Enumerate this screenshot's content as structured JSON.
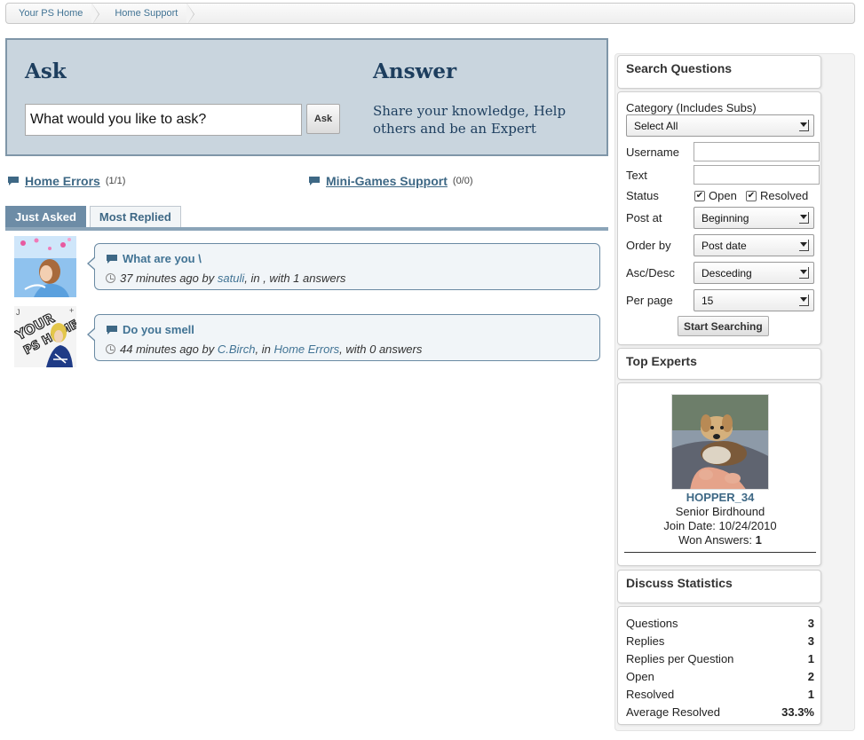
{
  "breadcrumb": [
    "Your PS Home",
    "Home Support"
  ],
  "ask": {
    "title": "Ask",
    "input_value": "What would you like to ask?",
    "button": "Ask"
  },
  "answer": {
    "title": "Answer",
    "text": "Share your knowledge, Help others and be an Expert"
  },
  "categories": [
    {
      "name": "Home Errors",
      "count": "(1/1)"
    },
    {
      "name": "Mini-Games Support",
      "count": "(0/0)"
    }
  ],
  "tabs": [
    "Just Asked",
    "Most Replied"
  ],
  "questions": [
    {
      "title": "What are you \\",
      "time": "37 minutes ago",
      "by": " by ",
      "user": "satuli",
      "mid": ", in ",
      "category": "",
      "tail": ", with 1 answers"
    },
    {
      "title": "Do you smell",
      "time": "44 minutes ago",
      "by": " by ",
      "user": "C.Birch",
      "mid": ", in ",
      "category": "Home Errors",
      "tail": ", with 0 answers"
    }
  ],
  "search": {
    "heading": "Search Questions",
    "category_label": "Category (Includes Subs)",
    "category_value": "Select All",
    "username_label": "Username",
    "text_label": "Text",
    "status_label": "Status",
    "status_open": "Open",
    "status_resolved": "Resolved",
    "post_at_label": "Post at",
    "post_at_value": "Beginning",
    "order_label": "Order by",
    "order_value": "Post date",
    "ascdesc_label": "Asc/Desc",
    "ascdesc_value": "Desceding",
    "per_page_label": "Per page",
    "per_page_value": "15",
    "button": "Start Searching"
  },
  "experts": {
    "heading": "Top Experts",
    "name": "HOPPER_34",
    "rank": "Senior Birdhound",
    "join": "Join Date: 10/24/2010",
    "won_label": "Won Answers: ",
    "won_value": "1"
  },
  "stats": {
    "heading": "Discuss Statistics",
    "rows": [
      {
        "label": "Questions",
        "value": "3"
      },
      {
        "label": "Replies",
        "value": "3"
      },
      {
        "label": "Replies per Question",
        "value": "1"
      },
      {
        "label": "Open",
        "value": "2"
      },
      {
        "label": "Resolved",
        "value": "1"
      },
      {
        "label": "Average Resolved",
        "value": "33.3%"
      }
    ]
  }
}
